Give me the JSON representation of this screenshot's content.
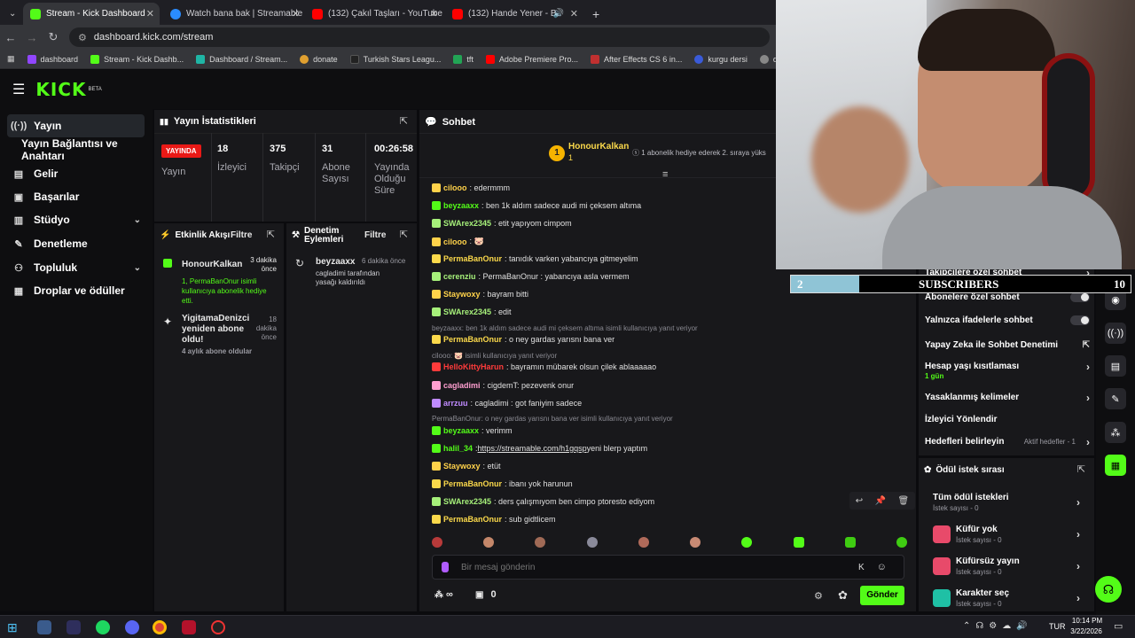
{
  "browser": {
    "tabs": [
      {
        "title": "Stream - Kick Dashboard",
        "color": "#53fc18"
      },
      {
        "title": "Watch bana bak | Streamable",
        "color": "#2a8cff"
      },
      {
        "title": "(132) Çakıl Taşları - YouTube",
        "color": "#ff0000"
      },
      {
        "title": "(132) Hande Yener - Bir Gi...",
        "color": "#ff0000"
      }
    ],
    "url": "dashboard.kick.com/stream",
    "bookmarks": [
      "dashboard",
      "Stream - Kick Dashb...",
      "Dashboard / Stream...",
      "donate",
      "Turkish Stars Leagu...",
      "tft",
      "Adobe Premiere Pro...",
      "After Effects CS 6 in...",
      "kurgu dersi",
      "darko",
      "coinmarket"
    ]
  },
  "kick": {
    "logo": "KICK",
    "beta": "BETA",
    "sidebar": [
      {
        "label": "Yayın",
        "icon": "((·))"
      },
      {
        "label": "Yayın Bağlantısı ve Anahtarı",
        "icon": ""
      },
      {
        "label": "Gelir",
        "icon": "▦"
      },
      {
        "label": "Başarılar",
        "icon": "▦"
      },
      {
        "label": "Stüdyo",
        "icon": "▦"
      },
      {
        "label": "Denetleme",
        "icon": "✎"
      },
      {
        "label": "Topluluk",
        "icon": "●"
      },
      {
        "label": "Droplar ve ödüller",
        "icon": "▦"
      }
    ],
    "stats": {
      "title": "Yayın İstatistikleri",
      "live": "YAYINDA",
      "live_sub": "Yayın",
      "viewers": "18",
      "viewers_lbl": "İzleyici",
      "followers": "375",
      "followers_lbl": "Takipçi",
      "subs": "31",
      "subs_lbl": "Abone Sayısı",
      "time": "00:26:58",
      "time_lbl": "Yayında Olduğu Süre"
    },
    "activity": {
      "title": "Etkinlik Akışı",
      "filter": "Filtre",
      "items": [
        {
          "user": "HonourKalkan",
          "time": "3 dakika önce",
          "text": "1, PermaBanOnur isimli kullanıcıya abonelik hediye etti."
        },
        {
          "user": "YigitamaDenizci yeniden abone oldu!",
          "time": "18 dakika önce",
          "text": "4 aylık abone oldular"
        }
      ]
    },
    "moderation": {
      "title": "Denetim Eylemleri",
      "filter": "Filtre",
      "user": "beyzaaxx",
      "time": "6 dakika önce",
      "text": "cagladimi tarafından yasağı kaldırıldı"
    },
    "chat": {
      "title": "Sohbet",
      "pinned_user": "HonourKalkan",
      "pinned_count": "1",
      "pinned_text": "1 abonelik hediye ederek 2. sıraya yüks",
      "lines": [
        {
          "user": "cilooo",
          "color": "#ffd24a",
          "text": ": edermmm"
        },
        {
          "user": "beyzaaxx",
          "color": "#53fc18",
          "text": ": ben 1k aldım sadece audi mi çeksem altıma"
        },
        {
          "user": "SWArex2345",
          "color": "#a6f07a",
          "text": ": etit yapıyom cimpom"
        },
        {
          "user": "cilooo",
          "color": "#ffd24a",
          "text": ": 🐷"
        },
        {
          "user": "PermaBanOnur",
          "color": "#fbd94b",
          "text": ": tanıdık varken yabancıya gitmeyelim"
        },
        {
          "user": "cerenziu",
          "color": "#a6f07a",
          "text": ": PermaBanOnur : yabancıya asla vermem"
        },
        {
          "user": "Staywoxy",
          "color": "#ffd24a",
          "text": ": bayram bitti"
        },
        {
          "user": "SWArex2345",
          "color": "#a6f07a",
          "text": ": edit"
        },
        {
          "user": "PermaBanOnur",
          "color": "#fbd94b",
          "text": ": o ney gardas yarısnı bana ver"
        },
        {
          "user": "HelloKittyHarun",
          "color": "#ff3b3b",
          "text": ": bayramın mübarek olsun çilek ablaaaaao"
        },
        {
          "user": "cagladimi",
          "color": "#ff9fd0",
          "text": ": cigdemT: pezevenk onur"
        },
        {
          "user": "arrzuu",
          "color": "#c08bff",
          "text": ": cagladimi : got faniyim sadece"
        },
        {
          "user": "beyzaaxx",
          "color": "#53fc18",
          "text": ": verimm"
        },
        {
          "user": "halil_34",
          "color": "#53fc18",
          "text": ": "
        },
        {
          "user": "Staywoxy",
          "color": "#ffd24a",
          "text": ": etüt"
        },
        {
          "user": "PermaBanOnur",
          "color": "#fbd94b",
          "text": ": ibanı yok harunun"
        },
        {
          "user": "SWArex2345",
          "color": "#a6f07a",
          "text": ": ders çalışmıyom ben cimpo ptoresto ediyom"
        },
        {
          "user": "PermaBanOnur",
          "color": "#fbd94b",
          "text": ": sub gidtlicem"
        }
      ],
      "link": "https://streamable.com/h1gqsp",
      "link_after": " yeni blerp yaptım",
      "reply1": "beyzaaxx: ben 1k aldım sadece audi mi çeksem altıma isimli kullanıcıya yanıt veriyor",
      "reply2": "cilooo: 🐷 isimli kullanıcıya yanıt veriyor",
      "reply3": "PermaBanOnur: o ney gardas yarısnı bana ver isimli kullanıcıya yanıt veriyor",
      "placeholder": "Bir mesaj gönderin",
      "points": "∞",
      "gifts": "0",
      "send": "Gönder"
    },
    "right": {
      "rows": [
        {
          "label": "Takipçilere özel sohbet",
          "kind": "chev"
        },
        {
          "label": "Abonelere özel sohbet",
          "kind": "toggle"
        },
        {
          "label": "Yalnızca ifadelerle sohbet",
          "kind": "toggle"
        },
        {
          "label": "Yapay Zeka ile Sohbet Denetimi",
          "kind": "ext"
        },
        {
          "label": "Hesap yaşı kısıtlaması",
          "kind": "chev",
          "sub": "1 gün"
        },
        {
          "label": "Yasaklanmış kelimeler",
          "kind": "chev"
        },
        {
          "label": "İzleyici Yönlendir",
          "kind": "none"
        },
        {
          "label": "Hedefleri belirleyin",
          "kind": "chev",
          "side": "Aktif hedefler - 1"
        }
      ],
      "rewards_title": "Ödül istek sırası",
      "rewards": [
        {
          "label": "Tüm ödül istekleri",
          "sub": "İstek sayısı - 0",
          "color": ""
        },
        {
          "label": "Küfür yok",
          "sub": "İstek sayısı - 0",
          "color": "#e84a6a"
        },
        {
          "label": "Küfürsüz yayın",
          "sub": "İstek sayısı - 0",
          "color": "#e84a6a"
        },
        {
          "label": "Karakter seç",
          "sub": "İstek sayısı - 0",
          "color": "#1fc0a5"
        }
      ]
    },
    "overlay": {
      "current": "2",
      "label": "SUBSCRIBERS",
      "goal": "10",
      "progress": 0.2
    }
  },
  "taskbar": {
    "lang": "TUR",
    "time": "10:14 PM",
    "date": "3/22/2026"
  }
}
